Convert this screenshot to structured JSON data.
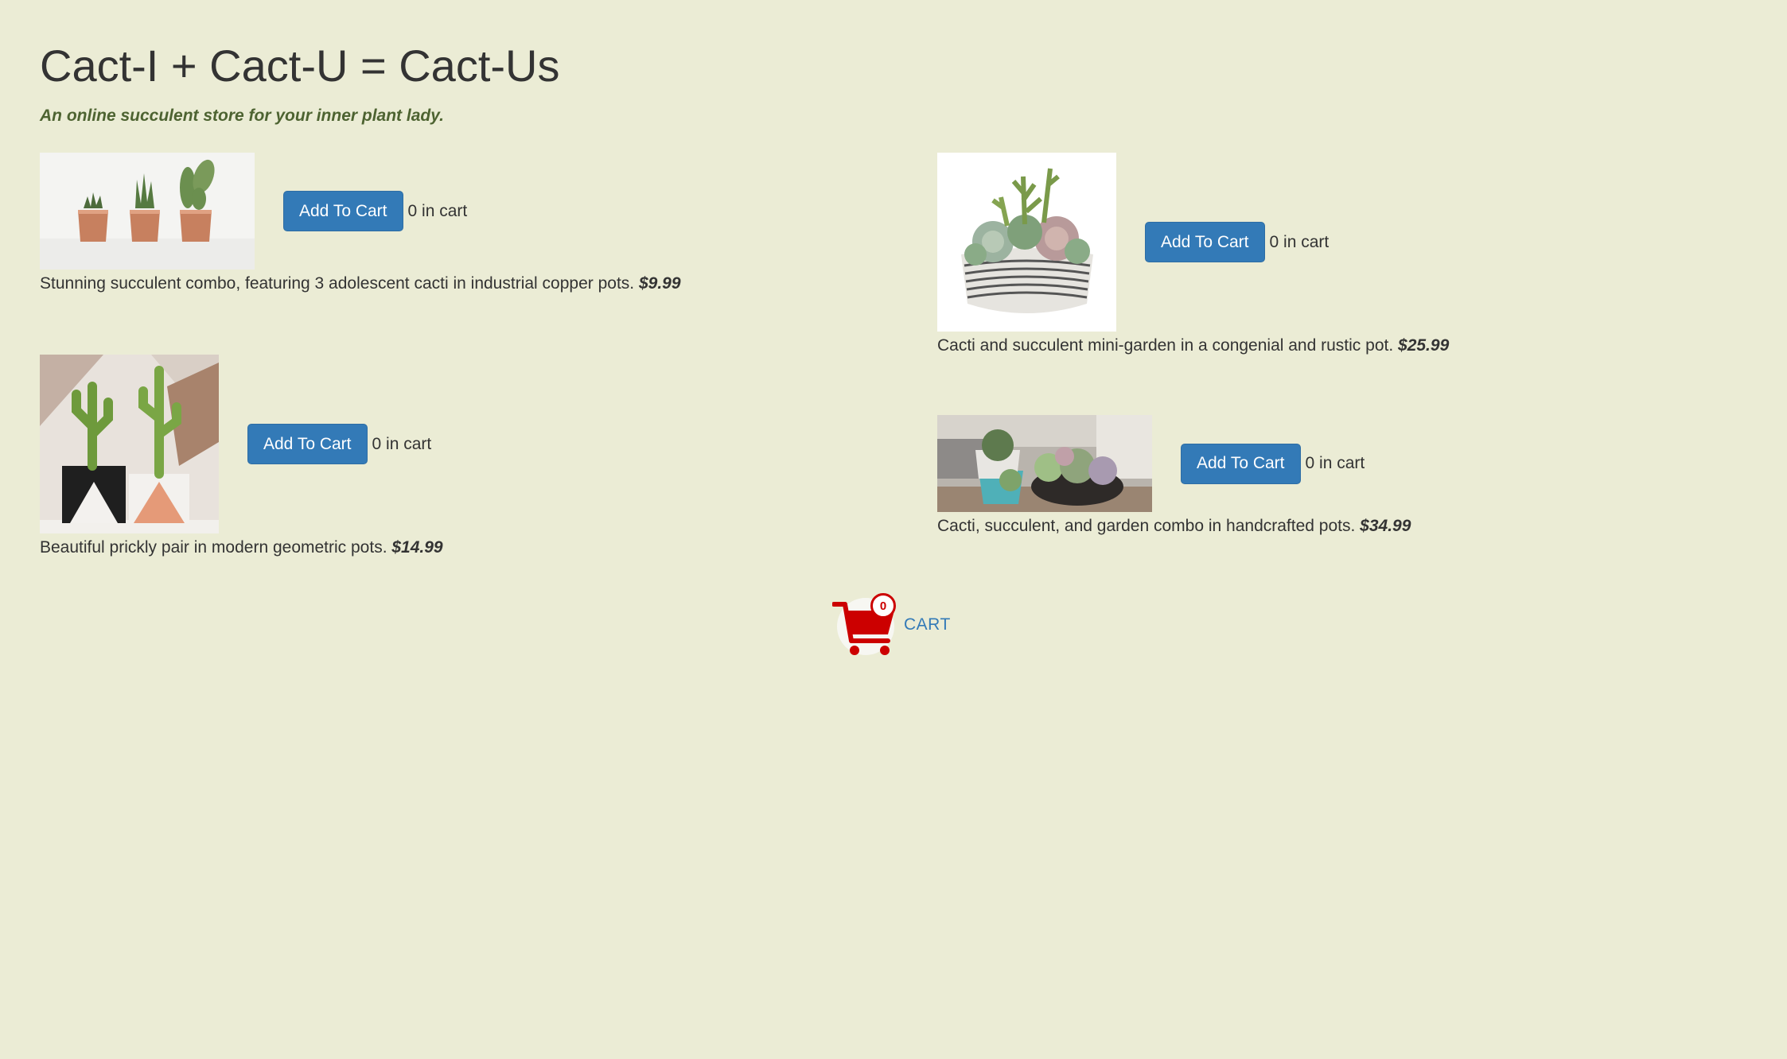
{
  "header": {
    "title": "Cact-I + Cact-U = Cact-Us",
    "tagline": "An online succulent store for your inner plant lady."
  },
  "products": [
    {
      "image_desc": "three cacti in copper pots",
      "button_label": "Add To Cart",
      "cart_count": "0 in cart",
      "description": "Stunning succulent combo, featuring 3 adolescent cacti in industrial copper pots.",
      "price": "$9.99"
    },
    {
      "image_desc": "succulent mini-garden in rustic bowl",
      "button_label": "Add To Cart",
      "cart_count": "0 in cart",
      "description": "Cacti and succulent mini-garden in a congenial and rustic pot.",
      "price": "$25.99"
    },
    {
      "image_desc": "two cacti in geometric pots",
      "button_label": "Add To Cart",
      "cart_count": "0 in cart",
      "description": "Beautiful prickly pair in modern geometric pots.",
      "price": "$14.99"
    },
    {
      "image_desc": "succulents in handcrafted pots",
      "button_label": "Add To Cart",
      "cart_count": "0 in cart",
      "description": "Cacti, succulent, and garden combo in handcrafted pots.",
      "price": "$34.99"
    }
  ],
  "cart": {
    "count": "0",
    "label": "CART",
    "icon": "shopping-cart-icon"
  },
  "colors": {
    "background": "#ebecd5",
    "button": "#337ab7",
    "tagline": "#4d6331",
    "cart_icon": "#cc0000"
  }
}
